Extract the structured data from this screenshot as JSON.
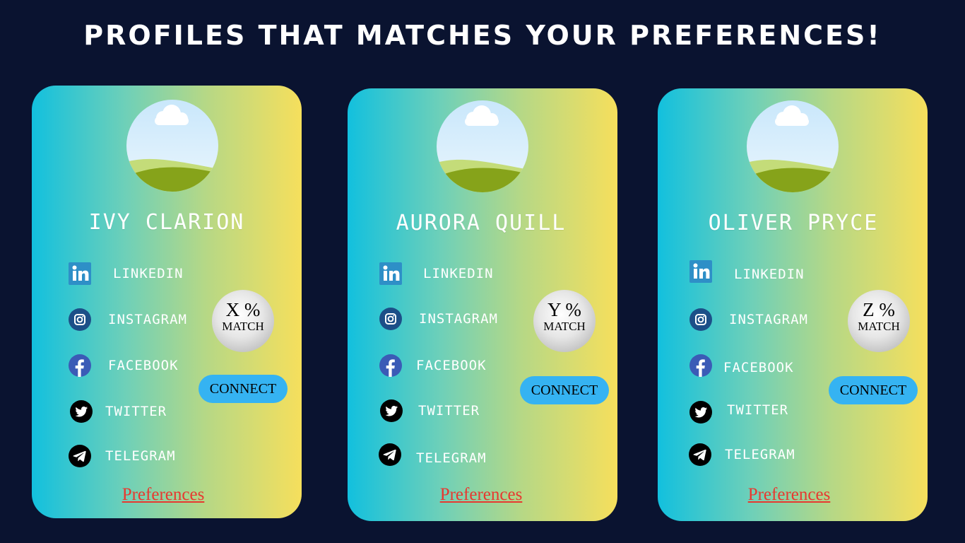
{
  "header": {
    "title": "PROFILES THAT MATCHES YOUR PREFERENCES!"
  },
  "colors": {
    "background": "#0a1330",
    "card_gradient": [
      "#12c0de",
      "#f6df5c"
    ],
    "connect_button": "#35b3f2",
    "preferences_link": "#e8382f"
  },
  "social_labels": {
    "linkedin": "LINKEDIN",
    "instagram": "INSTAGRAM",
    "facebook": "FACEBOOK",
    "twitter": "TWITTER",
    "telegram": "TELEGRAM"
  },
  "icons": {
    "avatar": "landscape-avatar-icon",
    "linkedin": "linkedin-icon",
    "instagram": "instagram-icon",
    "facebook": "facebook-icon",
    "twitter": "twitter-icon",
    "telegram": "telegram-icon"
  },
  "profiles": [
    {
      "name": "IVY CLARION",
      "match_value": "X %",
      "match_label": "MATCH",
      "connect_label": "CONNECT",
      "preferences_label": "Preferences"
    },
    {
      "name": "AURORA QUILL",
      "match_value": "Y %",
      "match_label": "MATCH",
      "connect_label": "CONNECT",
      "preferences_label": "Preferences"
    },
    {
      "name": "OLIVER PRYCE",
      "match_value": "Z %",
      "match_label": "MATCH",
      "connect_label": "CONNECT",
      "preferences_label": "Preferences"
    }
  ]
}
